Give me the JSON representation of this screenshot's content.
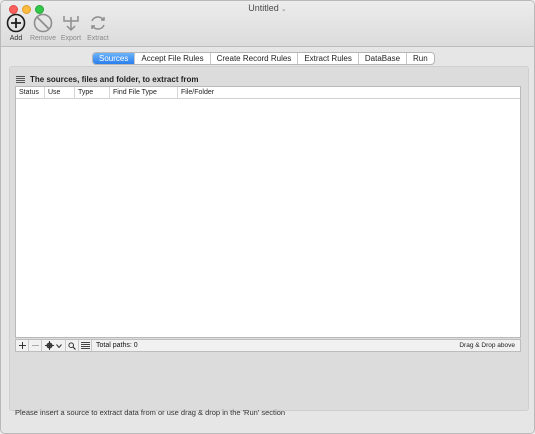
{
  "window": {
    "title": "Untitled"
  },
  "toolbar": {
    "add": "Add",
    "remove": "Remove",
    "export": "Export",
    "extract": "Extract"
  },
  "tabs": [
    {
      "label": "Sources"
    },
    {
      "label": "Accept File Rules"
    },
    {
      "label": "Create Record Rules"
    },
    {
      "label": "Extract Rules"
    },
    {
      "label": "DataBase"
    },
    {
      "label": "Run"
    }
  ],
  "sources": {
    "heading": "The sources, files and folder, to extract from",
    "columns": [
      "Status",
      "Use",
      "Type",
      "Find File Type",
      "File/Folder"
    ],
    "rows": [],
    "total_paths": "Total paths: 0",
    "drag_drop": "Drag & Drop above"
  },
  "hint": "Please insert a source to extract data from or use drag & drop in the 'Run' section",
  "colors": {
    "accent": "#2a7fee"
  }
}
